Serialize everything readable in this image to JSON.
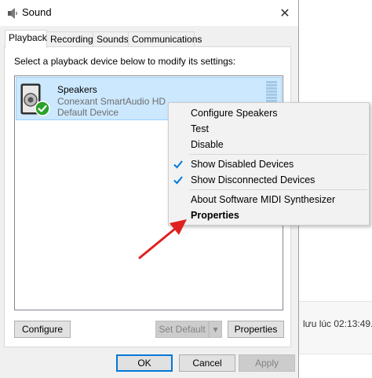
{
  "window": {
    "title": "Sound",
    "close_glyph": "✕",
    "tabs": [
      {
        "label": "Playback",
        "active": true
      },
      {
        "label": "Recording",
        "active": false
      },
      {
        "label": "Sounds",
        "active": false
      },
      {
        "label": "Communications",
        "active": false
      }
    ]
  },
  "playback": {
    "instruction": "Select a playback device below to modify its settings:",
    "devices": [
      {
        "name": "Speakers",
        "description": "Conexant SmartAudio HD",
        "status": "Default Device",
        "icon": "speaker-icon",
        "badge": "default-check-icon",
        "selected": true
      }
    ]
  },
  "buttons": {
    "configure": "Configure",
    "set_default": "Set Default",
    "dropdown_glyph": "▾",
    "properties": "Properties",
    "ok": "OK",
    "cancel": "Cancel",
    "apply": "Apply"
  },
  "context_menu": {
    "items": [
      {
        "label": "Configure Speakers",
        "checked": false,
        "bold": false
      },
      {
        "label": "Test",
        "checked": false,
        "bold": false
      },
      {
        "label": "Disable",
        "checked": false,
        "bold": false
      },
      {
        "label": "Show Disabled Devices",
        "checked": true,
        "bold": false
      },
      {
        "label": "Show Disconnected Devices",
        "checked": true,
        "bold": false
      },
      {
        "label": "About Software MIDI Synthesizer",
        "checked": false,
        "bold": false
      },
      {
        "label": "Properties",
        "checked": false,
        "bold": true
      }
    ]
  },
  "background_window": {
    "text": "lưu lúc 02:13:49..."
  },
  "colors": {
    "selection": "#cce8ff",
    "accent": "#0078d7",
    "check_green": "#2aa12a",
    "annotation_arrow": "#e02020"
  }
}
